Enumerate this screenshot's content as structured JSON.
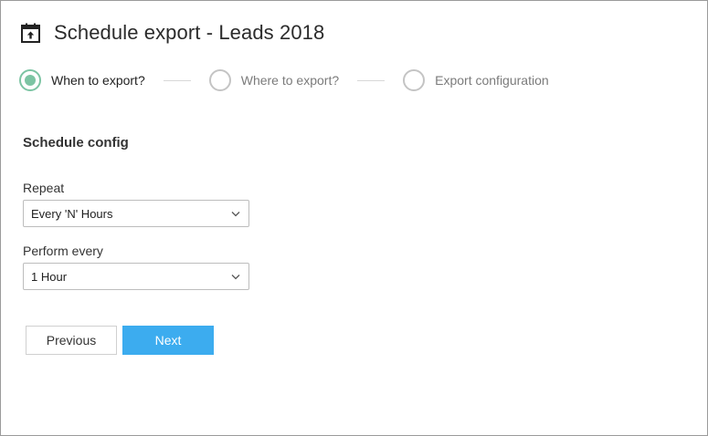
{
  "header": {
    "icon": "calendar-export-icon",
    "title": "Schedule export - Leads 2018"
  },
  "stepper": {
    "active_color": "#7cc4a3",
    "steps": [
      {
        "label": "When to export?",
        "active": true
      },
      {
        "label": "Where to export?",
        "active": false
      },
      {
        "label": "Export configuration",
        "active": false
      }
    ]
  },
  "form": {
    "section_title": "Schedule config",
    "repeat": {
      "label": "Repeat",
      "value": "Every 'N' Hours"
    },
    "perform_every": {
      "label": "Perform every",
      "value": "1 Hour"
    }
  },
  "actions": {
    "previous_label": "Previous",
    "next_label": "Next",
    "next_color": "#3cacef"
  }
}
